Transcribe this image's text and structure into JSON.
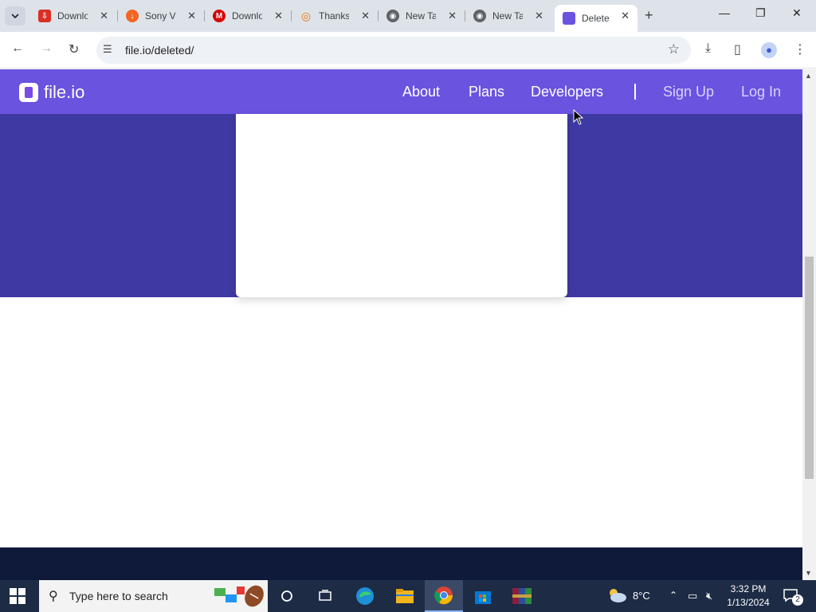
{
  "browser": {
    "tabs": [
      {
        "title": "Downlo",
        "favicon": "pdf-download-icon",
        "color": "#d93025"
      },
      {
        "title": "Sony V",
        "favicon": "download-arrow-icon",
        "color": "#f26522"
      },
      {
        "title": "Downlo",
        "favicon": "m-logo-icon",
        "color": "#d60000"
      },
      {
        "title": "Thanks",
        "favicon": "blender-icon",
        "color": "#ea7600"
      },
      {
        "title": "New Ta",
        "favicon": "chrome-icon",
        "color": "#5f6368"
      },
      {
        "title": "New Ta",
        "favicon": "chrome-icon",
        "color": "#5f6368"
      },
      {
        "title": "Delete",
        "favicon": "fileio-icon",
        "color": "#6a53df"
      }
    ],
    "active_tab_index": 6,
    "url": "file.io/deleted/",
    "window_controls": {
      "minimize": "—",
      "restore": "❐",
      "close": "✕"
    }
  },
  "site": {
    "logo_text": "file.io",
    "nav": {
      "about": "About",
      "plans": "Plans",
      "developers": "Developers",
      "signup": "Sign Up",
      "login": "Log In"
    },
    "colors": {
      "navbar": "#6a53df",
      "hero": "#3f3aa3",
      "footer": "#0f1a3a"
    }
  },
  "taskbar": {
    "search_placeholder": "Type here to search",
    "weather": "8°C",
    "time": "3:32 PM",
    "date": "1/13/2024",
    "notification_count": "2"
  }
}
